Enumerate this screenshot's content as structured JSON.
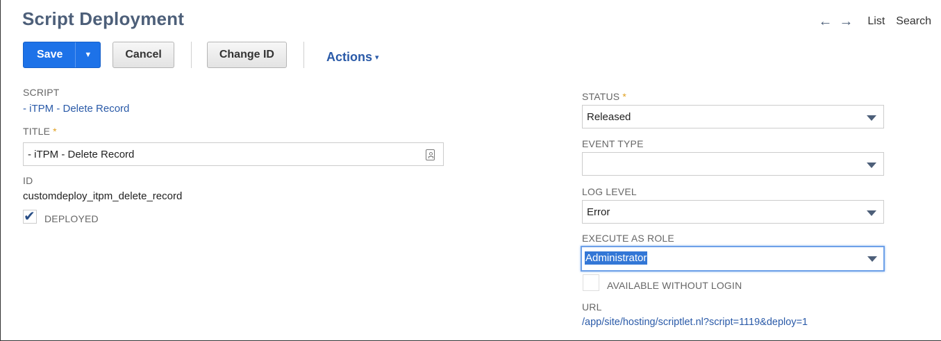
{
  "page": {
    "title": "Script Deployment"
  },
  "nav": {
    "back_icon": "arrow-left-icon",
    "forward_icon": "arrow-right-icon",
    "back": "←",
    "forward": "→",
    "list": "List",
    "search": "Search"
  },
  "toolbar": {
    "save": "Save",
    "save_menu": "▼",
    "cancel": "Cancel",
    "change_id": "Change ID",
    "actions": "Actions",
    "actions_caret": "▾",
    "accent_color": "#1d72e8"
  },
  "left": {
    "script": {
      "label": "SCRIPT",
      "value": "- iTPM - Delete Record"
    },
    "title": {
      "label": "TITLE",
      "required": "*",
      "value": "- iTPM - Delete Record"
    },
    "id": {
      "label": "ID",
      "value": "customdeploy_itpm_delete_record"
    },
    "deployed": {
      "label": "DEPLOYED",
      "checked": true,
      "mark": "✔"
    }
  },
  "right": {
    "status": {
      "label": "STATUS",
      "required": "*",
      "value": "Released"
    },
    "event_type": {
      "label": "EVENT TYPE",
      "value": ""
    },
    "log_level": {
      "label": "LOG LEVEL",
      "value": "Error"
    },
    "execute_as_role": {
      "label": "EXECUTE AS ROLE",
      "value": "Administrator"
    },
    "available_without_login": {
      "label": "AVAILABLE WITHOUT LOGIN",
      "checked": false
    },
    "url": {
      "label": "URL",
      "value": "/app/site/hosting/scriptlet.nl?script=1119&deploy=1"
    }
  }
}
